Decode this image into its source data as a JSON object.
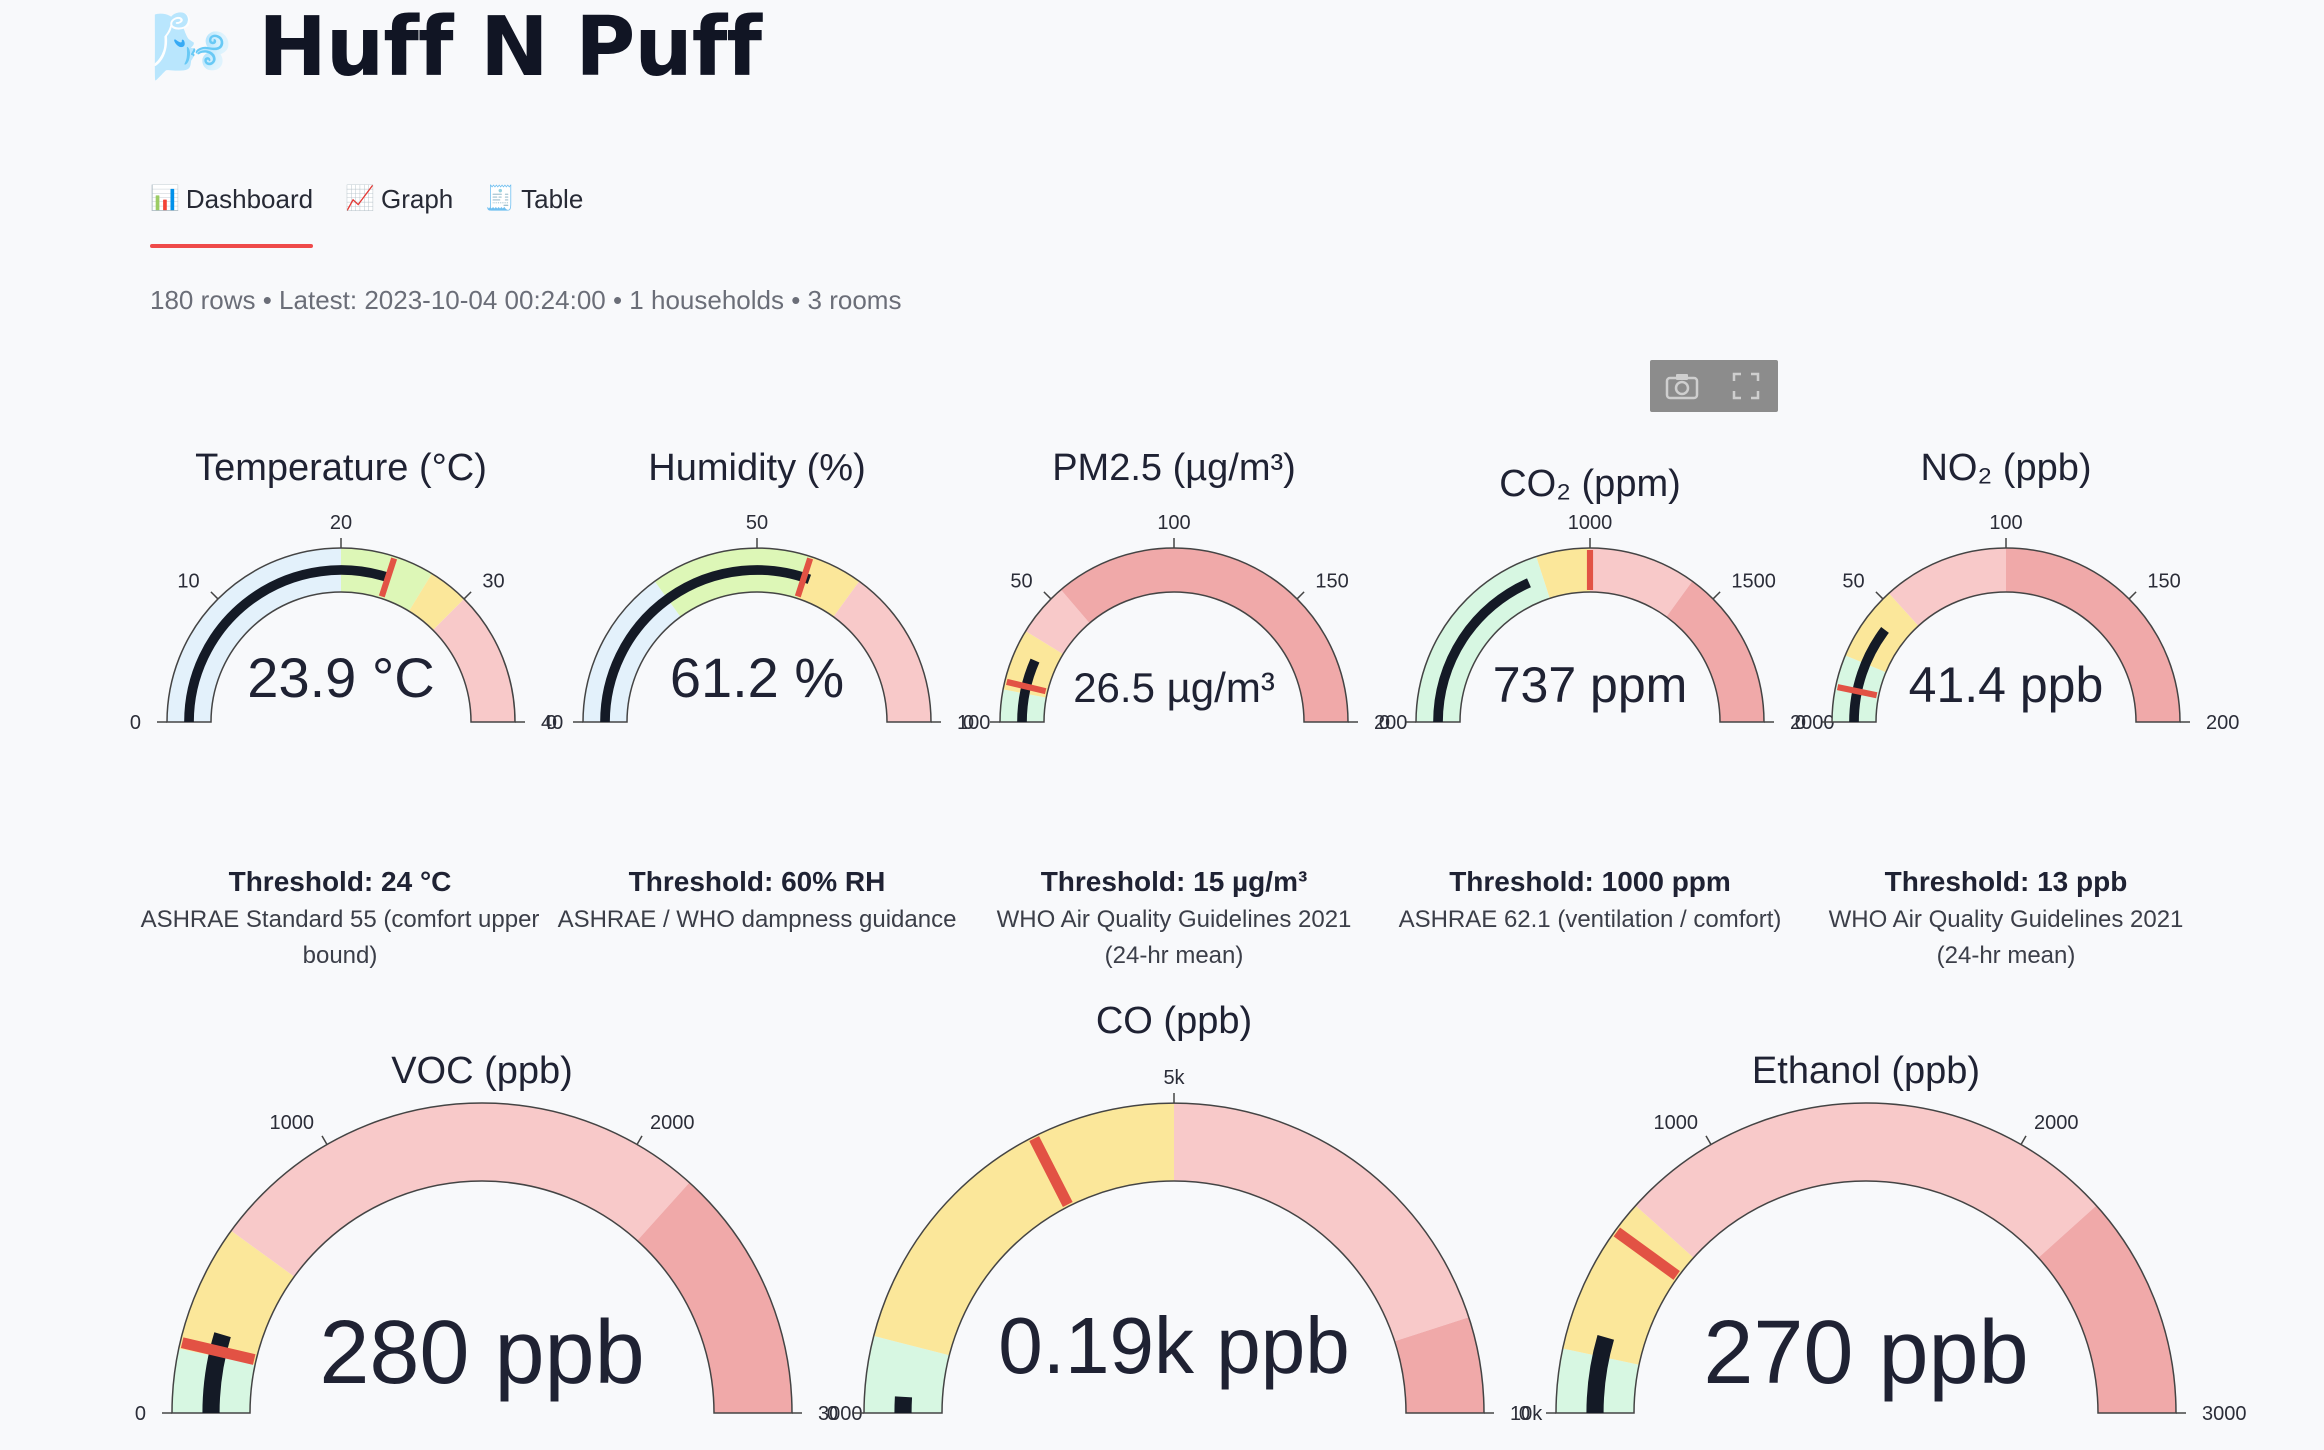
{
  "app": {
    "title": "Huff N Puff",
    "emoji": "🌬️"
  },
  "tabs": [
    {
      "label": "Dashboard",
      "icon": "📊",
      "icon_name": "bar-chart-icon",
      "active": true
    },
    {
      "label": "Graph",
      "icon": "📈",
      "icon_name": "line-chart-icon",
      "active": false
    },
    {
      "label": "Table",
      "icon": "🧾",
      "icon_name": "table-icon",
      "active": false
    }
  ],
  "summary": "180 rows • Latest: 2023-10-04 00:24:00 • 1 households • 3 rooms",
  "modebar": {
    "camera_icon": "camera-icon",
    "fullscreen_icon": "fullscreen-icon"
  },
  "colors": {
    "band_blue": "#e3f1fb",
    "band_green": "#ddf7b7",
    "band_yellow": "#fbe79a",
    "band_mint": "#d7f7e2",
    "band_pink": "#f8c9c9",
    "band_red": "#f0a9a9",
    "needle": "#141a26",
    "threshold": "#e25244",
    "accent": "#ef4a4a"
  },
  "gauges": [
    {
      "id": "temperature",
      "title": "Temperature (°C)",
      "value_text": "23.9 °C",
      "value": 23.9,
      "min": 0,
      "max": 40,
      "threshold": 24,
      "ticks": [
        "0",
        "10",
        "20",
        "30",
        "40"
      ],
      "bands": [
        [
          0,
          20,
          "band_blue"
        ],
        [
          20,
          27,
          "band_green"
        ],
        [
          27,
          30,
          "band_yellow"
        ],
        [
          30,
          40,
          "band_pink"
        ]
      ],
      "threshold_label": "Threshold: 24 °C",
      "source": "ASHRAE Standard 55 (comfort upper bound)"
    },
    {
      "id": "humidity",
      "title": "Humidity (%)",
      "value_text": "61.2 %",
      "value": 61.2,
      "min": 0,
      "max": 100,
      "threshold": 60,
      "ticks": [
        "0",
        "50",
        "100"
      ],
      "bands": [
        [
          0,
          30,
          "band_blue"
        ],
        [
          30,
          60,
          "band_green"
        ],
        [
          60,
          70,
          "band_yellow"
        ],
        [
          70,
          100,
          "band_pink"
        ]
      ],
      "threshold_label": "Threshold: 60% RH",
      "source": "ASHRAE / WHO dampness guidance"
    },
    {
      "id": "pm25",
      "title": "PM2.5 (µg/m³)",
      "value_text": "26.5 µg/m³",
      "value": 26.5,
      "min": 0,
      "max": 200,
      "threshold": 15,
      "ticks": [
        "0",
        "50",
        "100",
        "150",
        "200"
      ],
      "bands": [
        [
          0,
          12,
          "band_mint"
        ],
        [
          12,
          35,
          "band_yellow"
        ],
        [
          35,
          55,
          "band_pink"
        ],
        [
          55,
          200,
          "band_red"
        ]
      ],
      "threshold_label": "Threshold: 15 µg/m³",
      "source": "WHO Air Quality Guidelines 2021 (24-hr mean)"
    },
    {
      "id": "co2",
      "title": "CO₂ (ppm)",
      "value_text": "737 ppm",
      "value": 737,
      "min": 0,
      "max": 2000,
      "threshold": 1000,
      "ticks": [
        "0",
        "1000",
        "1500",
        "2000"
      ],
      "bands": [
        [
          0,
          800,
          "band_mint"
        ],
        [
          800,
          1000,
          "band_yellow"
        ],
        [
          1000,
          1400,
          "band_pink"
        ],
        [
          1400,
          2000,
          "band_red"
        ]
      ],
      "threshold_label": "Threshold: 1000 ppm",
      "source": "ASHRAE 62.1 (ventilation / comfort)"
    },
    {
      "id": "no2",
      "title": "NO₂ (ppb)",
      "value_text": "41.4 ppb",
      "value": 41.4,
      "min": 0,
      "max": 200,
      "threshold": 13,
      "ticks": [
        "0",
        "50",
        "100",
        "150",
        "200"
      ],
      "bands": [
        [
          0,
          25,
          "band_mint"
        ],
        [
          25,
          53,
          "band_yellow"
        ],
        [
          53,
          100,
          "band_pink"
        ],
        [
          100,
          200,
          "band_red"
        ]
      ],
      "threshold_label": "Threshold: 13 ppb",
      "source": "WHO Air Quality Guidelines 2021 (24-hr mean)"
    },
    {
      "id": "voc",
      "title": "VOC (ppb)",
      "value_text": "280 ppb",
      "value": 280,
      "min": 0,
      "max": 3000,
      "threshold": 220,
      "ticks": [
        "0",
        "1000",
        "2000",
        "3000"
      ],
      "bands": [
        [
          0,
          200,
          "band_mint"
        ],
        [
          200,
          600,
          "band_yellow"
        ],
        [
          600,
          2200,
          "band_pink"
        ],
        [
          2200,
          3000,
          "band_red"
        ]
      ]
    },
    {
      "id": "co",
      "title": "CO (ppb)",
      "value_text": "0.19k ppb",
      "value": 190,
      "min": 0,
      "max": 10000,
      "threshold": 3500,
      "ticks": [
        "0",
        "5k",
        "10k"
      ],
      "bands": [
        [
          0,
          800,
          "band_mint"
        ],
        [
          800,
          5000,
          "band_yellow"
        ],
        [
          5000,
          9000,
          "band_pink"
        ],
        [
          9000,
          10000,
          "band_red"
        ]
      ]
    },
    {
      "id": "ethanol",
      "title": "Ethanol (ppb)",
      "value_text": "270 ppb",
      "value": 270,
      "min": 0,
      "max": 3000,
      "threshold": 600,
      "ticks": [
        "0",
        "1000",
        "2000",
        "3000"
      ],
      "bands": [
        [
          0,
          200,
          "band_mint"
        ],
        [
          200,
          700,
          "band_yellow"
        ],
        [
          700,
          2300,
          "band_pink"
        ],
        [
          2300,
          3000,
          "band_red"
        ]
      ]
    }
  ]
}
